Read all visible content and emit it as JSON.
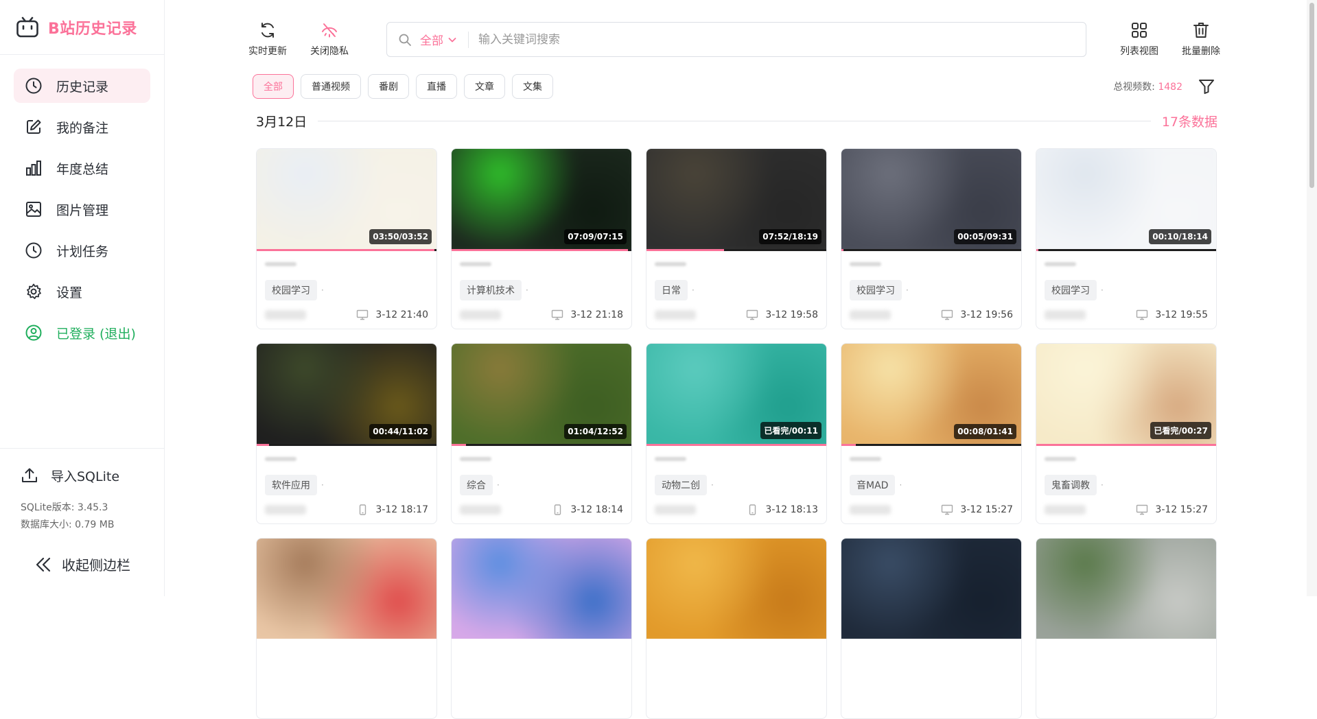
{
  "app": {
    "title": "B站历史记录"
  },
  "sidebar": {
    "items": [
      {
        "label": "历史记录",
        "icon": "clock-icon",
        "active": true
      },
      {
        "label": "我的备注",
        "icon": "edit-icon"
      },
      {
        "label": "年度总结",
        "icon": "bar-chart-icon"
      },
      {
        "label": "图片管理",
        "icon": "image-icon"
      },
      {
        "label": "计划任务",
        "icon": "clock-icon"
      },
      {
        "label": "设置",
        "icon": "gear-icon"
      },
      {
        "label": "已登录 (退出)",
        "icon": "user-circle-icon"
      }
    ],
    "import_label": "导入SQLite",
    "sqlite_version": "SQLite版本: 3.45.3",
    "db_size": "数据库大小: 0.79 MB",
    "collapse_label": "收起侧边栏"
  },
  "toolbar": {
    "refresh_label": "实时更新",
    "privacy_label": "关闭隐私",
    "list_view_label": "列表视图",
    "batch_delete_label": "批量删除"
  },
  "search": {
    "scope": "全部",
    "placeholder": "输入关键词搜索"
  },
  "filters": {
    "chips": [
      "全部",
      "普通视频",
      "番剧",
      "直播",
      "文章",
      "文集"
    ],
    "total_label": "总视频数:",
    "total_value": "1482"
  },
  "section": {
    "date": "3月12日",
    "count": "17条数据"
  },
  "colors": {
    "accent": "#fb7299",
    "login": "#1fae5c",
    "active_bg": "#fdeef2"
  },
  "cards": [
    {
      "duration": "03:50/03:52",
      "progress": 0.99,
      "tag": "校园学习",
      "device": "pc",
      "time": "3-12 21:40",
      "thumb": [
        "#f4f1e6",
        "#e9eef5",
        "#f7f3e9"
      ]
    },
    {
      "duration": "07:09/07:15",
      "progress": 0.98,
      "tag": "计算机技术",
      "device": "pc",
      "time": "3-12 21:18",
      "thumb": [
        "#1d2a1f",
        "#2fbf2a",
        "#0f1a11"
      ]
    },
    {
      "duration": "07:52/18:19",
      "progress": 0.43,
      "tag": "日常",
      "device": "pc",
      "time": "3-12 19:58",
      "thumb": [
        "#2f2f2f",
        "#4a4438",
        "#262626"
      ]
    },
    {
      "duration": "00:05/09:31",
      "progress": 0.01,
      "tag": "校园学习",
      "device": "pc",
      "time": "3-12 19:56",
      "thumb": [
        "#4a4d59",
        "#6d707c",
        "#3a3d48"
      ]
    },
    {
      "duration": "00:10/18:14",
      "progress": 0.01,
      "tag": "校园学习",
      "device": "pc",
      "time": "3-12 19:55",
      "thumb": [
        "#f3f5f8",
        "#dfe6ee",
        "#f6f7f9"
      ]
    },
    {
      "duration": "00:44/11:02",
      "progress": 0.07,
      "tag": "软件应用",
      "device": "mobile",
      "time": "3-12 18:17",
      "thumb": [
        "#1f1f1f",
        "#3e4a2a",
        "#6b5a1a"
      ]
    },
    {
      "duration": "01:04/12:52",
      "progress": 0.08,
      "tag": "综合",
      "device": "mobile",
      "time": "3-12 18:14",
      "thumb": [
        "#4e6e2a",
        "#8a7a3a",
        "#3d5e22"
      ]
    },
    {
      "duration": "已看完/00:11",
      "progress": 1,
      "tag": "动物二创",
      "device": "mobile",
      "time": "3-12 18:13",
      "thumb": [
        "#39b7a6",
        "#5ccbbe",
        "#1f9e8d"
      ]
    },
    {
      "duration": "00:08/01:41",
      "progress": 0.08,
      "tag": "音MAD",
      "device": "pc",
      "time": "3-12 15:27",
      "thumb": [
        "#e8b46a",
        "#f6e2a8",
        "#c98848"
      ]
    },
    {
      "duration": "已看完/00:27",
      "progress": 1,
      "tag": "鬼畜调教",
      "device": "pc",
      "time": "3-12 15:27",
      "thumb": [
        "#f6eac8",
        "#fbf4d8",
        "#d7a980"
      ]
    },
    {
      "thumb": [
        "#e9c6a5",
        "#a47a5a",
        "#e04b4b"
      ]
    },
    {
      "thumb": [
        "#d7a8e8",
        "#5a8ee0",
        "#3a6fc8"
      ]
    },
    {
      "thumb": [
        "#e29a2a",
        "#f0b84a",
        "#c77a1a"
      ]
    },
    {
      "thumb": [
        "#1f2a3a",
        "#3a4d66",
        "#16202e"
      ]
    },
    {
      "thumb": [
        "#9aa29a",
        "#5a7a4a",
        "#c8cac6"
      ]
    }
  ]
}
